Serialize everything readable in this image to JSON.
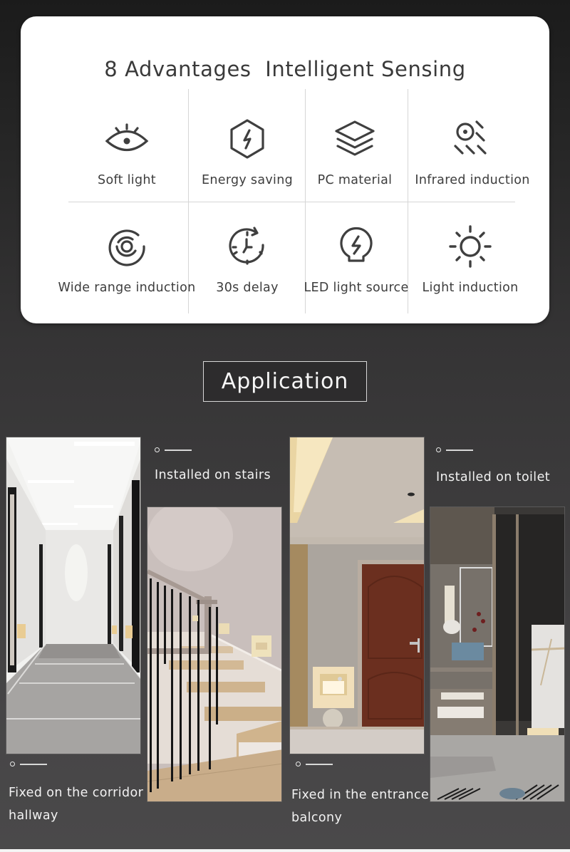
{
  "advantages": {
    "title": "8 Advantages  Intelligent Sensing",
    "items": [
      {
        "label": "Soft light",
        "icon": "eye-icon"
      },
      {
        "label": "Energy saving",
        "icon": "hexagon-bolt-icon"
      },
      {
        "label": "PC material",
        "icon": "layers-icon"
      },
      {
        "label": "Infrared induction",
        "icon": "infrared-sensor-icon"
      },
      {
        "label": "Wide range induction",
        "icon": "concentric-circles-icon"
      },
      {
        "label": "30s delay",
        "icon": "clock-refresh-icon"
      },
      {
        "label": "LED light source",
        "icon": "bulb-bolt-icon"
      },
      {
        "label": "Light induction",
        "icon": "sun-icon"
      }
    ]
  },
  "application": {
    "heading": "Application",
    "scenes": [
      {
        "caption_line1": "Fixed on the corridor",
        "caption_line2": "hallway",
        "photo": "corridor-hallway-photo"
      },
      {
        "caption_line1": "Installed on stairs",
        "caption_line2": "",
        "photo": "stairs-photo"
      },
      {
        "caption_line1": "Fixed in the entrance",
        "caption_line2": "balcony",
        "photo": "entrance-door-photo"
      },
      {
        "caption_line1": "Installed on toilet",
        "caption_line2": "",
        "photo": "bathroom-photo"
      }
    ]
  },
  "colors": {
    "card_bg": "#ffffff",
    "icon_stroke": "#3f3f3f",
    "page_bg_top": "#1b1b1b",
    "page_bg_bottom": "#4a494a",
    "caption_text": "#f2f2f2",
    "light_panel": "#f3e2bd"
  }
}
